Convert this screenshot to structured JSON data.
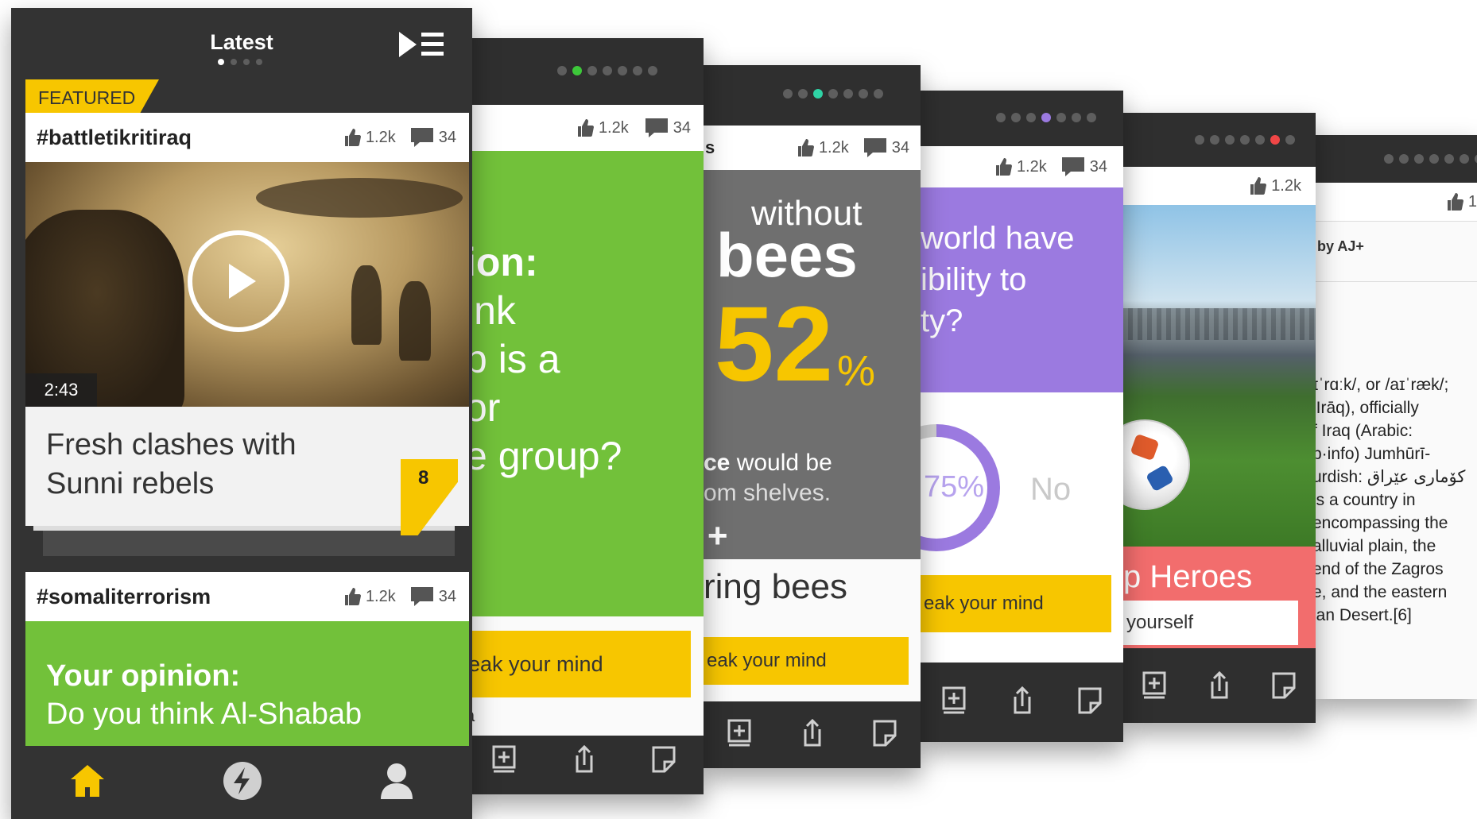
{
  "colors": {
    "dark": "#2f2f2f",
    "yellow": "#f7c600",
    "green": "#72c13a",
    "purple": "#9b7ae0",
    "coral": "#f26d6d",
    "grey": "#6f6f6f"
  },
  "main_phone": {
    "header_title": "Latest",
    "featured_label": "FEATURED",
    "card1": {
      "hashtag": "#battletikritiraq",
      "likes": "1.2k",
      "comments": "34",
      "duration": "2:43",
      "headline_line1": "Fresh clashes with",
      "headline_line2": "Sunni rebels",
      "count": "8"
    },
    "card2": {
      "hashtag": "#somaliterrorism",
      "likes": "1.2k",
      "comments": "34",
      "title": "Your opinion:",
      "subtitle": "Do you think Al-Shabab"
    },
    "nav": [
      "home-icon",
      "bolt-icon",
      "user-icon"
    ]
  },
  "phone2": {
    "likes": "1.2k",
    "comments": "34",
    "lines": [
      "ion:",
      "ink",
      "b is a",
      "or",
      "e group?"
    ],
    "button": "eak your mind",
    "footer_letter": "a"
  },
  "phone3": {
    "likes": "1.2k",
    "comments": "34",
    "bar_letter": "s",
    "word_without": "without",
    "word_bees": "bees",
    "stat_number": "52",
    "stat_percent": "%",
    "line1_bold": "ce",
    "line1": " would be",
    "line2": "om shelves.",
    "logo_text": "+",
    "title": "ring bees",
    "button": "eak your mind"
  },
  "phone4": {
    "likes": "1.2k",
    "comments": "34",
    "lines": [
      "world have",
      "ibility to",
      "ty?"
    ],
    "percent": "75%",
    "no_label": "No",
    "button": "eak your mind"
  },
  "phone5": {
    "likes": "1.2k",
    "title": "p Heroes",
    "input_text": "yourself"
  },
  "phone6": {
    "likes": "1",
    "byline": "by AJ+",
    "lines": [
      "ɪˈrɑːk/, or /aɪˈræk/;",
      "ʻIrāq), officially",
      "f Iraq (Arabic:",
      "p·info) Jumhūrī-",
      "urdish: كۆماری عێراق",
      "is a country in",
      "encompassing the",
      "alluvial plain, the",
      "end of the Zagros",
      "e, and the eastern",
      "ian Desert.[6]"
    ]
  }
}
